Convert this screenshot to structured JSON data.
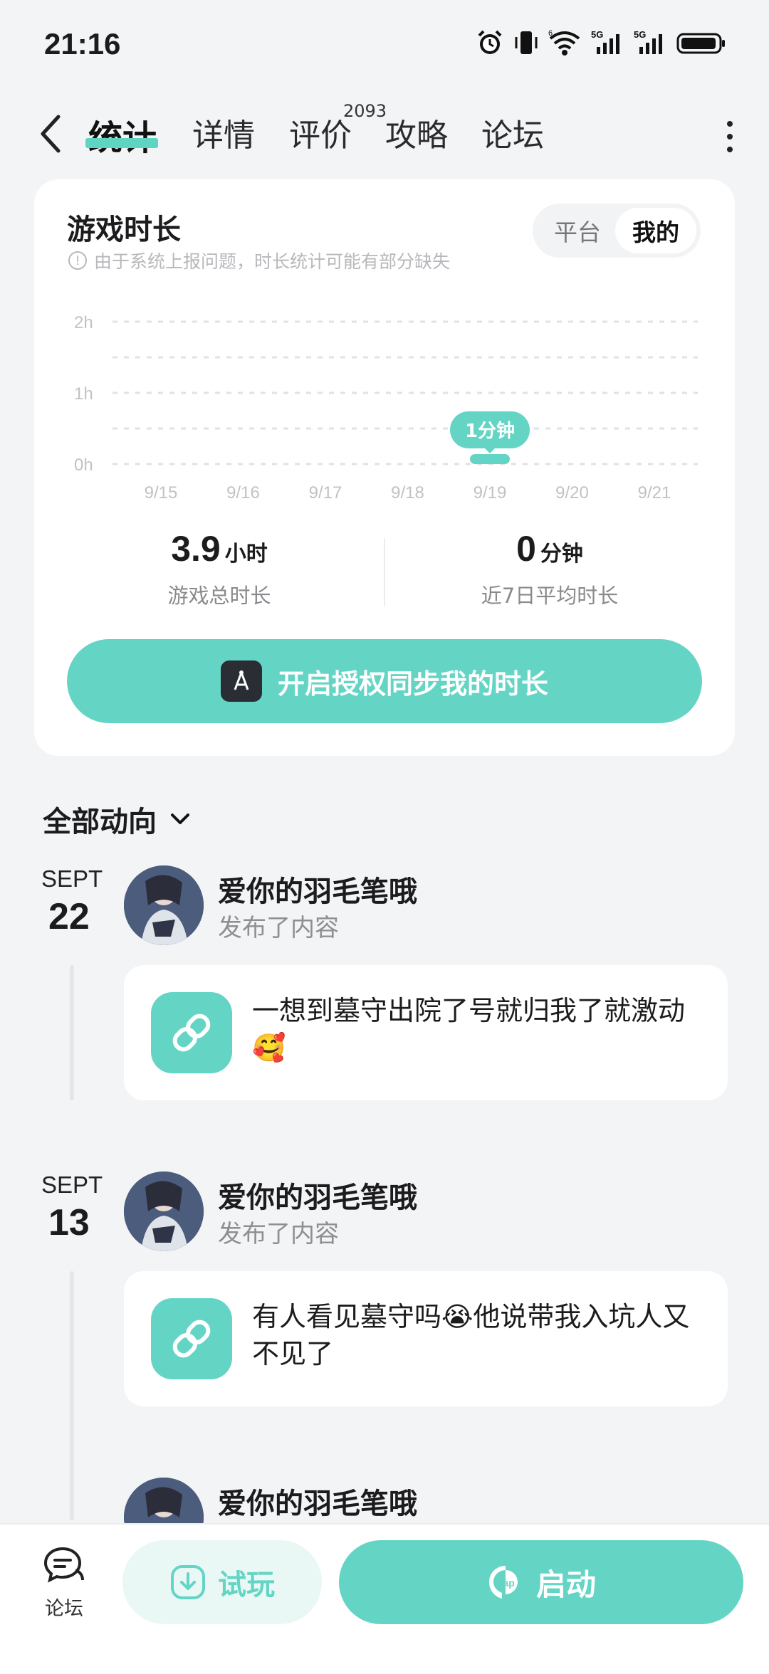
{
  "status_bar": {
    "time": "21:16",
    "network_1": "5G",
    "network_2": "5G",
    "badge": "6"
  },
  "nav": {
    "tabs": [
      {
        "label": "统计",
        "active": true
      },
      {
        "label": "详情",
        "active": false
      },
      {
        "label": "评价",
        "active": false,
        "badge": "2093"
      },
      {
        "label": "攻略",
        "active": false
      },
      {
        "label": "论坛",
        "active": false
      }
    ]
  },
  "stats": {
    "title": "游戏时长",
    "note": "由于系统上报问题，时长统计可能有部分缺失",
    "toggle": {
      "option_platform": "平台",
      "option_mine": "我的",
      "selected": "我的"
    },
    "total_value": "3.9",
    "total_unit": "小时",
    "total_label": "游戏总时长",
    "avg_value": "0",
    "avg_unit": "分钟",
    "avg_label": "近7日平均时长",
    "sync_button": "开启授权同步我的时长"
  },
  "chart_data": {
    "type": "bar",
    "categories": [
      "9/15",
      "9/16",
      "9/17",
      "9/18",
      "9/19",
      "9/20",
      "9/21"
    ],
    "values": [
      0,
      0,
      0,
      0,
      1,
      0,
      0
    ],
    "unit": "分钟",
    "y_ticks": [
      "0h",
      "1h",
      "2h"
    ],
    "ylim": [
      0,
      120
    ],
    "tooltip": {
      "category": "9/19",
      "label": "1分钟"
    },
    "grid": true,
    "color": "#64d5c5"
  },
  "feed": {
    "header": "全部动向",
    "posts": [
      {
        "month": "SEPT",
        "day": "22",
        "user": "爱你的羽毛笔哦",
        "action": "发布了内容",
        "text": "一想到墓守出院了号就归我了就激动🥰"
      },
      {
        "month": "SEPT",
        "day": "13",
        "user": "爱你的羽毛笔哦",
        "action": "发布了内容",
        "text": "有人看见墓守吗😭他说带我入坑人又不见了"
      },
      {
        "month": "",
        "day": "",
        "user": "爱你的羽毛笔哦",
        "action": "",
        "text": ""
      }
    ]
  },
  "bottom_bar": {
    "forum_label": "论坛",
    "try_label": "试玩",
    "launch_label": "启动",
    "launch_logo_text": "Tap"
  },
  "colors": {
    "accent": "#64d5c5",
    "background": "#f3f4f6"
  }
}
